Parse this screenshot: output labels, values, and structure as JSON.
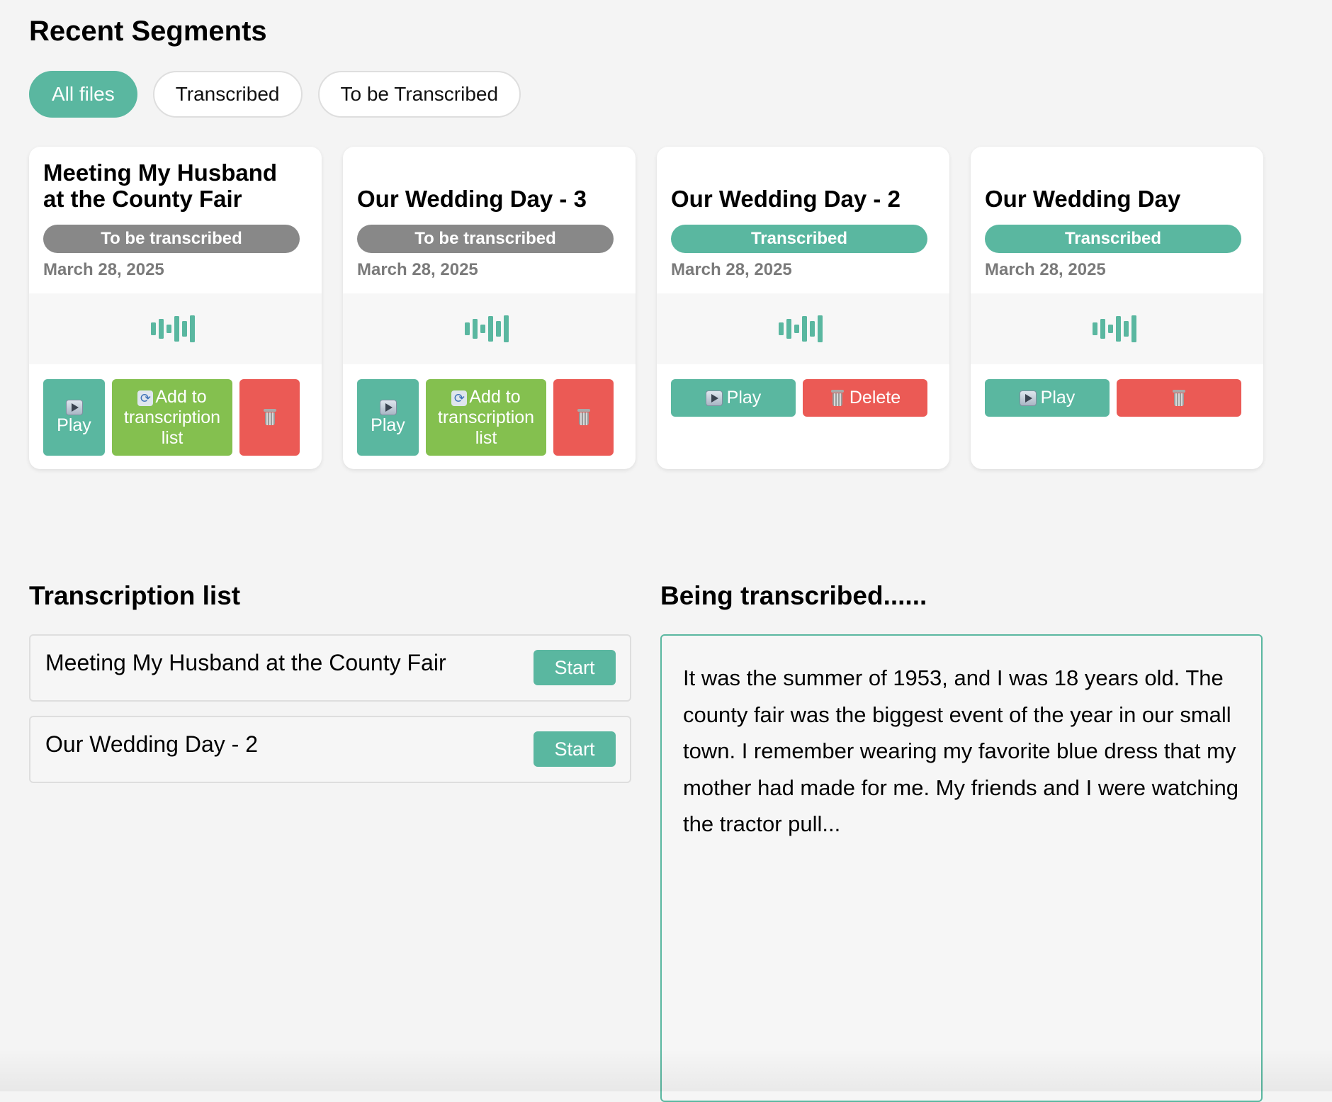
{
  "recent": {
    "title": "Recent Segments",
    "filters": [
      "All files",
      "Transcribed",
      "To be Transcribed"
    ],
    "active_filter": "All files"
  },
  "cards": [
    {
      "title": "Meeting My Husband at the County Fair",
      "status": "To be transcribed",
      "status_color": "#888888",
      "date": "March 28, 2025",
      "buttons": {
        "play": "Play",
        "add": "Add to transcription list"
      }
    },
    {
      "title": "Our Wedding Day - 3",
      "status": "To be transcribed",
      "status_color": "#888888",
      "date": "March 28, 2025",
      "buttons": {
        "play": "Play",
        "add": "Add to transcription list"
      }
    },
    {
      "title": "Our Wedding Day - 2",
      "status": "Transcribed",
      "status_color": "#5ab7a0",
      "date": "March 28, 2025",
      "buttons": {
        "play": "Play",
        "delete": "Delete"
      }
    },
    {
      "title": "Our Wedding Day",
      "status": "Transcribed",
      "status_color": "#5ab7a0",
      "date": "March 28, 2025",
      "buttons": {
        "play": "Play"
      }
    }
  ],
  "transcription_list": {
    "title": "Transcription list",
    "items": [
      {
        "name": "Meeting My Husband at the County Fair",
        "action": "Start"
      },
      {
        "name": "Our Wedding Day - 2",
        "action": "Start"
      }
    ]
  },
  "being_transcribed": {
    "title": "Being transcribed......",
    "text": "It was the summer of 1953, and I was 18 years old. The county fair was the biggest event of the year in our small town. I remember wearing my favorite blue dress that my mother had made for me. My friends and I were watching the tractor pull..."
  },
  "icons": {
    "play": "play-icon",
    "refresh": "refresh-icon",
    "delete": "trash-icon",
    "waveform": "waveform-icon"
  },
  "colors": {
    "accent": "#5ab7a0",
    "add": "#84c04f",
    "danger": "#eb5a55",
    "pending": "#888888"
  }
}
